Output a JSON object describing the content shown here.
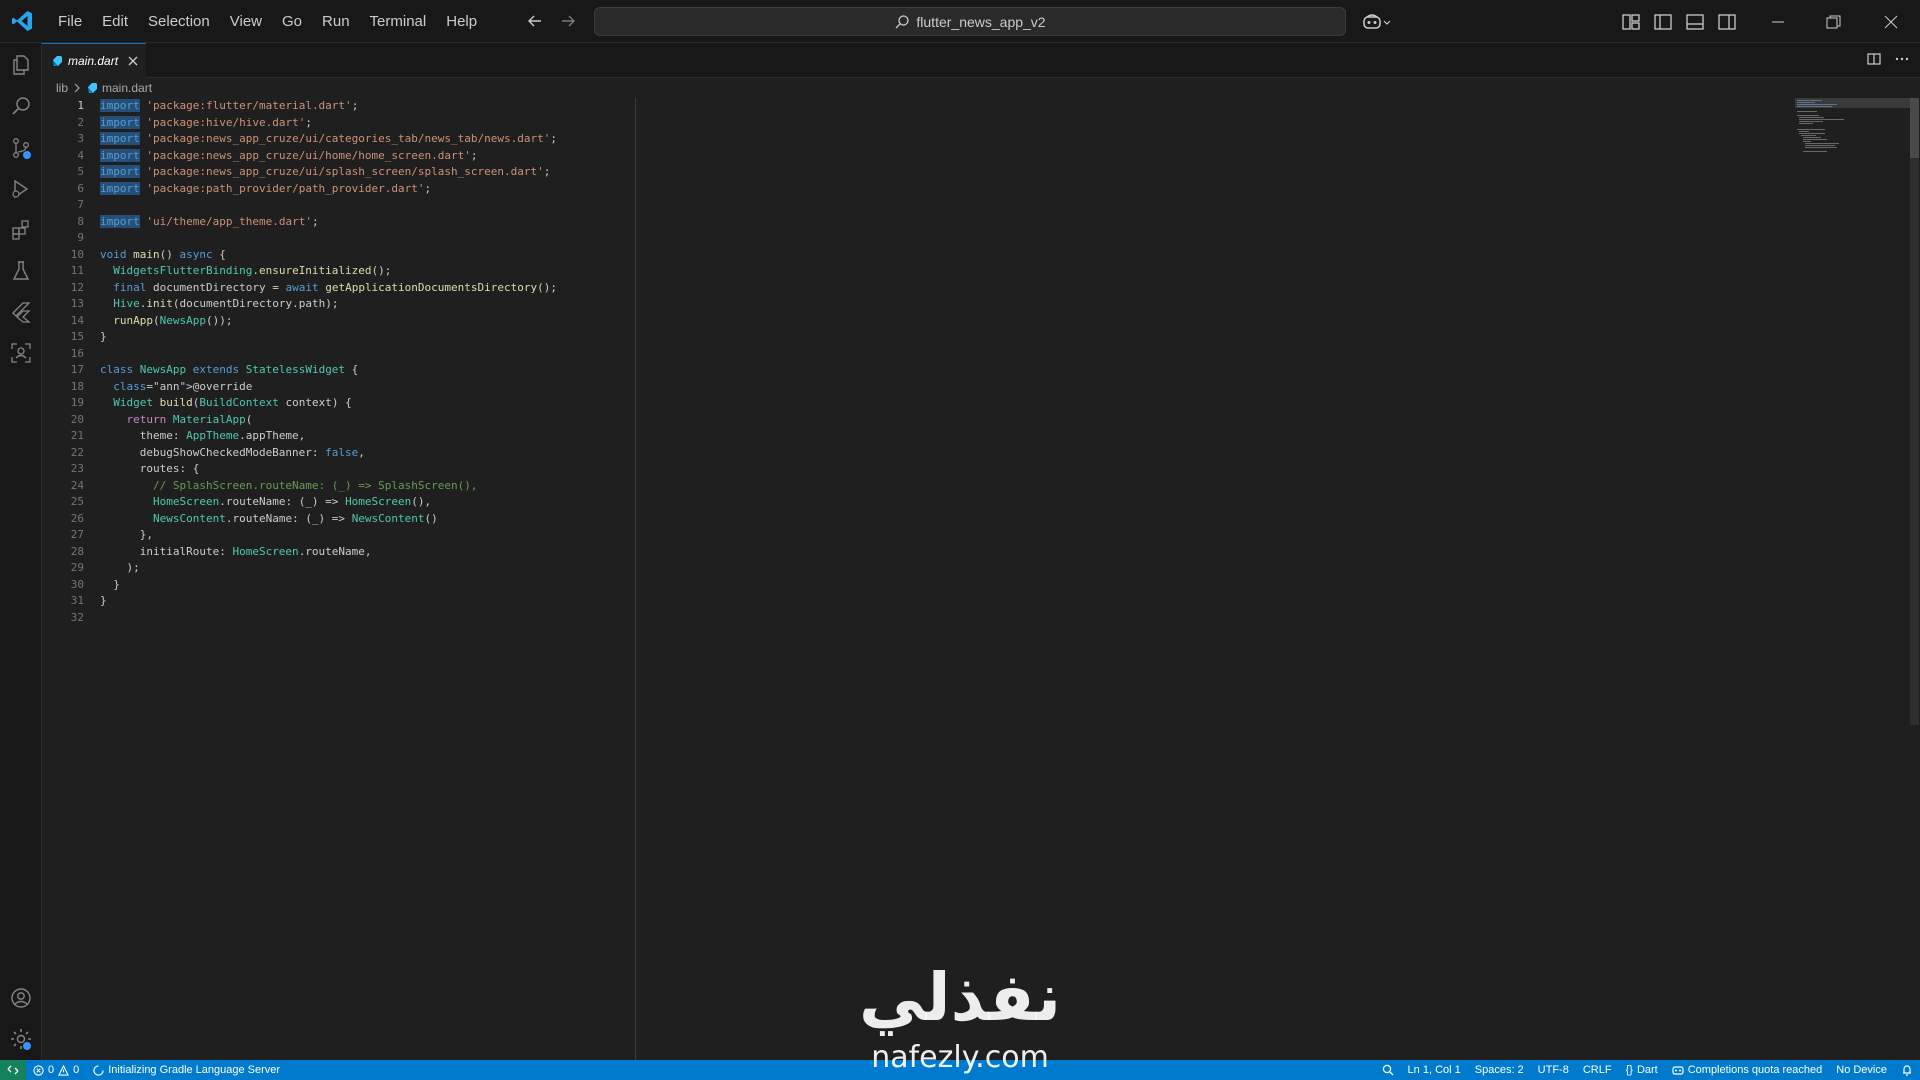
{
  "window": {
    "search_text": "flutter_news_app_v2"
  },
  "menu": [
    "File",
    "Edit",
    "Selection",
    "View",
    "Go",
    "Run",
    "Terminal",
    "Help"
  ],
  "tabs": [
    {
      "label": "main.dart",
      "icon": "dart-file-icon"
    }
  ],
  "breadcrumb": {
    "folder": "lib",
    "file": "main.dart"
  },
  "editor": {
    "active_line": 1,
    "line_numbers": [
      "1",
      "2",
      "3",
      "4",
      "5",
      "6",
      "7",
      "8",
      "9",
      "10",
      "11",
      "12",
      "13",
      "14",
      "15",
      "16",
      "17",
      "18",
      "19",
      "20",
      "21",
      "22",
      "23",
      "24",
      "25",
      "26",
      "27",
      "28",
      "29",
      "30",
      "31",
      "32"
    ],
    "lines": [
      "import 'package:flutter/material.dart';",
      "import 'package:hive/hive.dart';",
      "import 'package:news_app_cruze/ui/categories_tab/news_tab/news.dart';",
      "import 'package:news_app_cruze/ui/home/home_screen.dart';",
      "import 'package:news_app_cruze/ui/splash_screen/splash_screen.dart';",
      "import 'package:path_provider/path_provider.dart';",
      "",
      "import 'ui/theme/app_theme.dart';",
      "",
      "void main() async {",
      "  WidgetsFlutterBinding.ensureInitialized();",
      "  final documentDirectory = await getApplicationDocumentsDirectory();",
      "  Hive.init(documentDirectory.path);",
      "  runApp(NewsApp());",
      "}",
      "",
      "class NewsApp extends StatelessWidget {",
      "  @override",
      "  Widget build(BuildContext context) {",
      "    return MaterialApp(",
      "      theme: AppTheme.appTheme,",
      "      debugShowCheckedModeBanner: false,",
      "      routes: {",
      "        // SplashScreen.routeName: (_) => SplashScreen(),",
      "        HomeScreen.routeName: (_) => HomeScreen(),",
      "        NewsContent.routeName: (_) => NewsContent()",
      "      },",
      "      initialRoute: HomeScreen.routeName,",
      "    );",
      "  }",
      "}",
      ""
    ]
  },
  "status": {
    "errors": "0",
    "warnings": "0",
    "message": "Initializing Gradle Language Server",
    "cursor": "Ln 1, Col 1",
    "indent": "Spaces: 2",
    "encoding": "UTF-8",
    "eol": "CRLF",
    "language": "Dart",
    "copilot": "Completions quota reached",
    "device": "No Device"
  },
  "watermark": {
    "arabic": "نفذلي",
    "latin": "nafezly.com"
  },
  "colors": {
    "accent": "#007acc",
    "keyword": "#569cd6",
    "string": "#ce9178",
    "type": "#4ec9b0",
    "function": "#dcdcaa",
    "comment": "#6a9955"
  }
}
